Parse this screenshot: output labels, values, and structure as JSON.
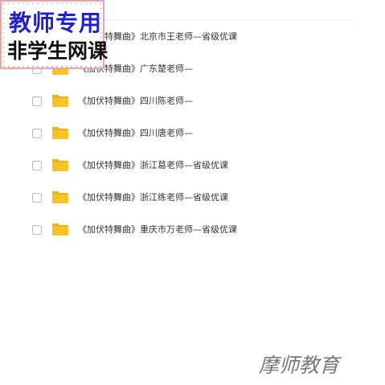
{
  "watermark": {
    "line1": "教师专用",
    "line2": "非学生网课"
  },
  "files": [
    {
      "name": "《加伏特舞曲》北京市王老师—省级优课",
      "icon": "folder-icon"
    },
    {
      "name": "《加伏特舞曲》广东楚老师—",
      "icon": "folder-icon"
    },
    {
      "name": "《加伏特舞曲》四川陈老师—",
      "icon": "folder-icon"
    },
    {
      "name": "《加伏特舞曲》四川唐老师—",
      "icon": "folder-icon"
    },
    {
      "name": "《加伏特舞曲》浙江葛老师—省级优课",
      "icon": "folder-icon"
    },
    {
      "name": "《加伏特舞曲》浙江练老师—省级优课",
      "icon": "folder-icon"
    },
    {
      "name": "《加伏特舞曲》重庆市万老师—省级优课",
      "icon": "folder-icon"
    }
  ],
  "signature": "摩师教育",
  "colors": {
    "folder": "#f7c325",
    "folder_tab": "#efb41a",
    "text": "#333333",
    "watermark_blue": "#2222cc"
  }
}
